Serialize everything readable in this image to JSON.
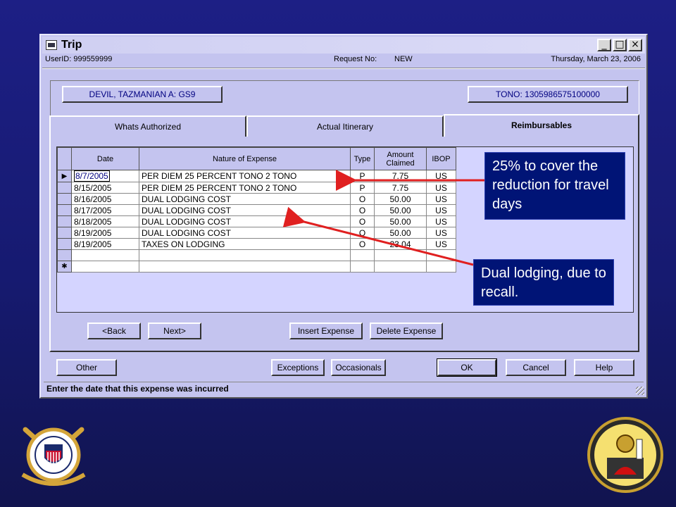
{
  "window": {
    "title": "Trip",
    "minimize": "_",
    "maximize": "□",
    "close": "×"
  },
  "info": {
    "user": "UserID: 999559999",
    "request_label": "Request No:",
    "request_value": "NEW",
    "date": "Thursday, March 23, 2006"
  },
  "header": {
    "member_button": "DEVIL, TAZMANIAN A: GS9",
    "tono_button": "TONO: 1305986575100000"
  },
  "tabs": [
    {
      "label": "Whats Authorized"
    },
    {
      "label": "Actual Itinerary"
    },
    {
      "label": "Reimbursables"
    }
  ],
  "grid": {
    "columns": [
      "Date",
      "Nature of Expense",
      "Type",
      "Amount Claimed",
      "IBOP"
    ],
    "rows": [
      {
        "date": "8/7/2005",
        "nature": "PER DIEM 25 PERCENT TONO 2 TONO",
        "type": "P",
        "amount": "7.75",
        "ibop": "US"
      },
      {
        "date": "8/15/2005",
        "nature": "PER DIEM 25 PERCENT TONO 2 TONO",
        "type": "P",
        "amount": "7.75",
        "ibop": "US"
      },
      {
        "date": "8/16/2005",
        "nature": "DUAL LODGING COST",
        "type": "O",
        "amount": "50.00",
        "ibop": "US"
      },
      {
        "date": "8/17/2005",
        "nature": "DUAL LODGING COST",
        "type": "O",
        "amount": "50.00",
        "ibop": "US"
      },
      {
        "date": "8/18/2005",
        "nature": "DUAL LODGING COST",
        "type": "O",
        "amount": "50.00",
        "ibop": "US"
      },
      {
        "date": "8/19/2005",
        "nature": "DUAL LODGING COST",
        "type": "O",
        "amount": "50.00",
        "ibop": "US"
      },
      {
        "date": "8/19/2005",
        "nature": "TAXES ON LODGING",
        "type": "O",
        "amount": "23.04",
        "ibop": "US"
      }
    ],
    "current_marker": "▶",
    "new_marker": "✱"
  },
  "nav": {
    "back": "<Back",
    "next": "Next>",
    "insert": "Insert Expense",
    "delete": "Delete Expense"
  },
  "footer": {
    "other": "Other",
    "exceptions": "Exceptions",
    "occasionals": "Occasionals",
    "ok": "OK",
    "cancel": "Cancel",
    "help": "Help"
  },
  "status": "Enter the date that this expense was incurred",
  "annotations": {
    "per_diem": "25% to cover the reduction for travel days",
    "dual_lodging": "Dual lodging, due to recall."
  },
  "colors": {
    "background": "#1d1f85",
    "window": "#c4c4ef",
    "annotation_box": "#001476",
    "arrow": "#e02020"
  }
}
